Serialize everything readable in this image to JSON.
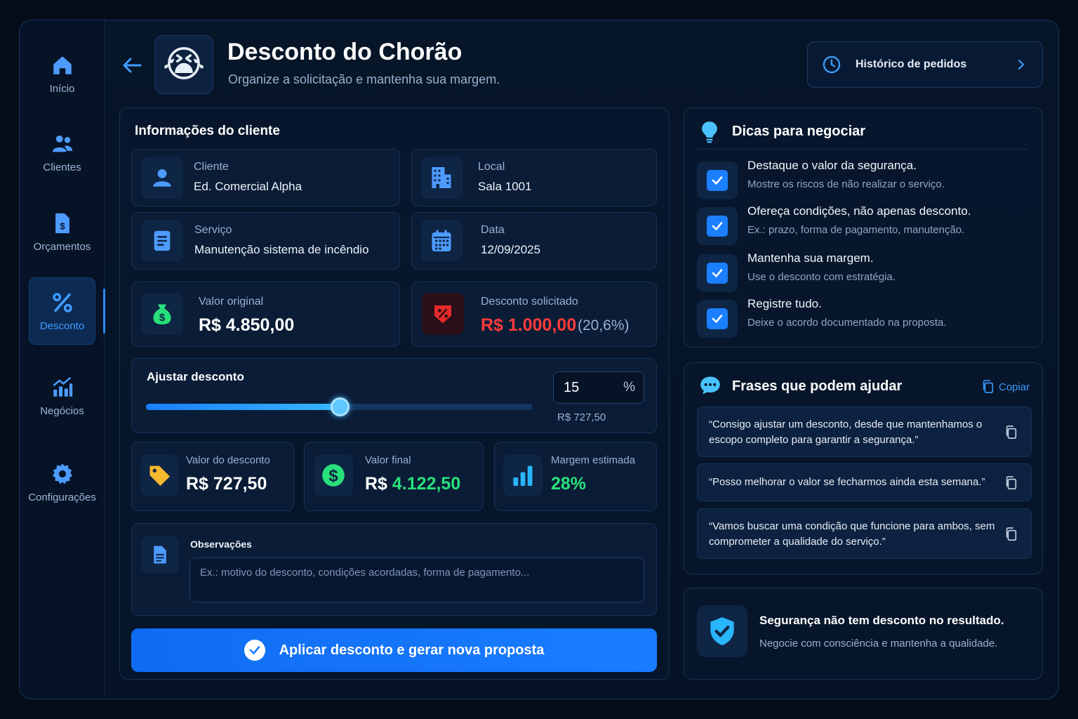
{
  "sidebar": {
    "items": [
      {
        "label": "Início",
        "icon": "home-icon"
      },
      {
        "label": "Clientes",
        "icon": "users-icon"
      },
      {
        "label": "Orçamentos",
        "icon": "budget-document-icon"
      },
      {
        "label": "Desconto",
        "icon": "percent-icon",
        "active": true
      },
      {
        "label": "Negócios",
        "icon": "chart-growth-icon"
      },
      {
        "label": "Configurações",
        "icon": "gear-icon"
      }
    ]
  },
  "header": {
    "title": "Desconto do Chorão",
    "subtitle": "Organize a solicitação e mantenha sua margem.",
    "avatar_emoji": "😭",
    "history_button": "Histórico de pedidos"
  },
  "client_info": {
    "section_title": "Informações do cliente",
    "client_label": "Cliente",
    "client_value": "Ed. Comercial Alpha",
    "location_label": "Local",
    "location_value": "Sala 1001",
    "service_label": "Serviço",
    "service_value": "Manutenção sistema de incêndio",
    "date_label": "Data",
    "date_value": "12/09/2025"
  },
  "amounts": {
    "original_label": "Valor original",
    "original_value": "R$ 4.850,00",
    "requested_label": "Desconto solicitado",
    "requested_value": "R$ 1.000,00",
    "requested_percent": "(20,6%)"
  },
  "adjust": {
    "label": "Ajustar desconto",
    "percent_value": "15",
    "percent_unit": "%",
    "amount_hint": "R$ 727,50",
    "slider_fraction": 0.5
  },
  "results": {
    "discount_label": "Valor do desconto",
    "discount_value": "R$ 727,50",
    "final_label": "Valor final",
    "final_currency": "R$",
    "final_value": "4.122,50",
    "margin_label": "Margem estimada",
    "margin_value": "28%"
  },
  "observations": {
    "label": "Observações",
    "placeholder": "Ex.: motivo do desconto, condições acordadas, forma de pagamento..."
  },
  "apply_button": "Aplicar desconto e gerar nova proposta",
  "tips": {
    "title": "Dicas para negociar",
    "items": [
      {
        "title": "Destaque o valor da segurança.",
        "sub": "Mostre os riscos de não realizar o serviço."
      },
      {
        "title": "Ofereça condições, não apenas desconto.",
        "sub": "Ex.: prazo, forma de pagamento, manutenção."
      },
      {
        "title": "Mantenha sua margem.",
        "sub": "Use o desconto com estratégia."
      },
      {
        "title": "Registre tudo.",
        "sub": "Deixe o acordo documentado na proposta."
      }
    ]
  },
  "phrases": {
    "title": "Frases que podem ajudar",
    "copy_label": "Copiar",
    "items": [
      "“Consigo ajustar um desconto, desde que mantenhamos o escopo completo para garantir a segurança.”",
      "“Posso melhorar o valor se fecharmos ainda esta semana.”",
      "“Vamos buscar uma condição que funcione para ambos, sem comprometer a qualidade do serviço.”"
    ]
  },
  "footer_card": {
    "title": "Segurança não tem desconto no resultado.",
    "sub": "Negocie com consciência e mantenha a qualidade."
  },
  "colors": {
    "accent": "#1a7dff",
    "danger": "#ff3b3b",
    "success": "#28e07a",
    "background": "#050d1a"
  }
}
